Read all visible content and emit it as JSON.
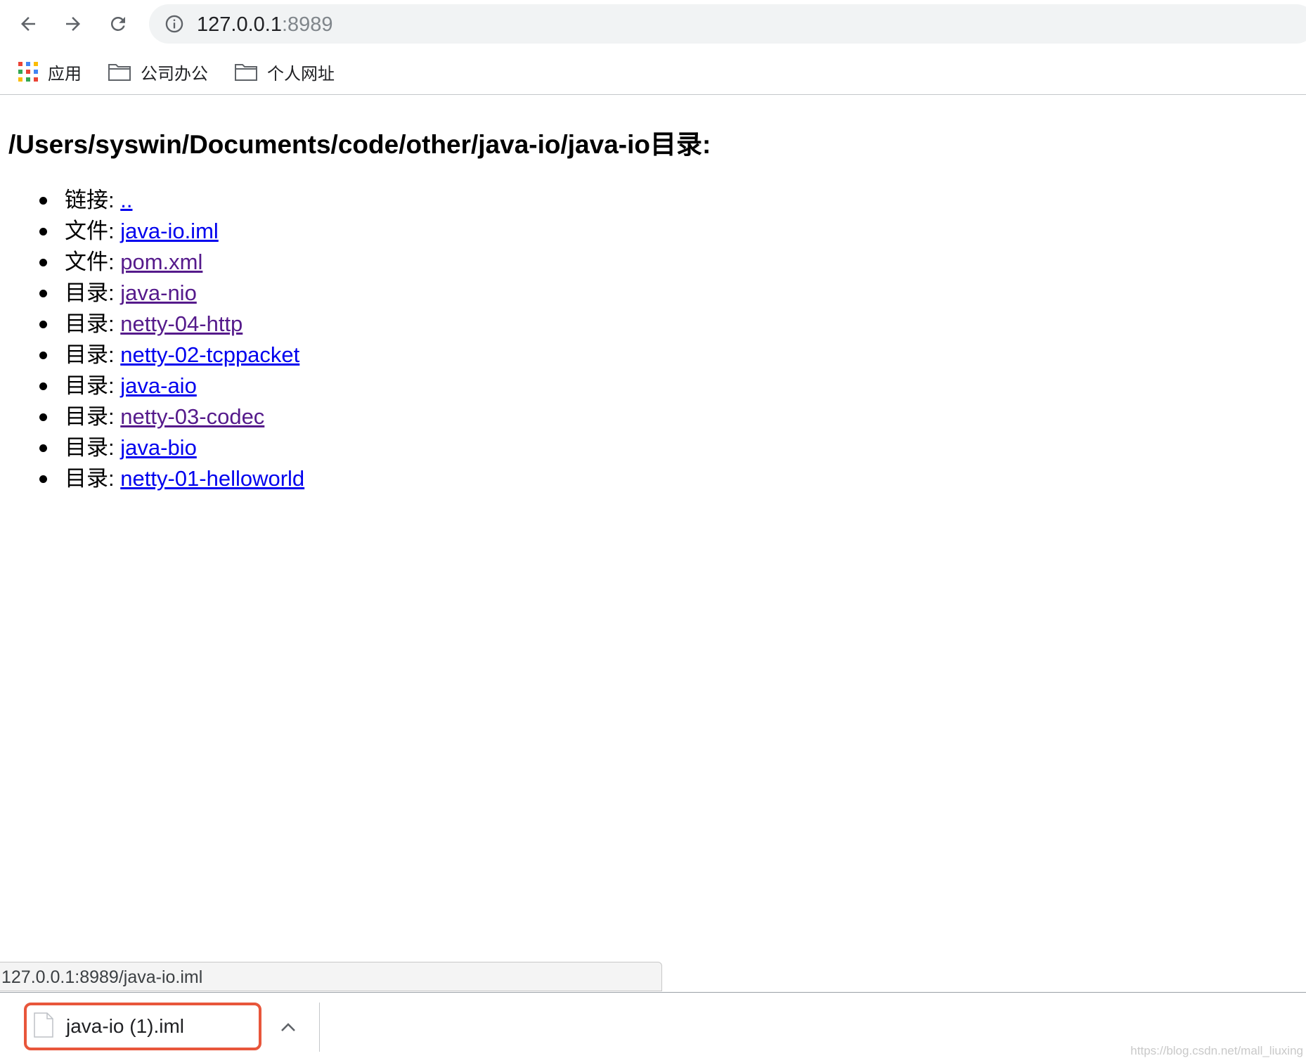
{
  "browser": {
    "url_host": "127.0.0.1",
    "url_port": ":8989",
    "icons": {
      "back": "arrow-left-icon",
      "forward": "arrow-right-icon",
      "reload": "reload-icon",
      "info": "info-icon"
    }
  },
  "bookmarks": [
    {
      "label": "应用",
      "icon": "apps-grid-icon"
    },
    {
      "label": "公司办公",
      "icon": "folder-icon"
    },
    {
      "label": "个人网址",
      "icon": "folder-icon"
    }
  ],
  "page": {
    "title": "/Users/syswin/Documents/code/other/java-io/java-io目录:",
    "entries": [
      {
        "kind": "链接:",
        "name": "..",
        "visited": false
      },
      {
        "kind": "文件:",
        "name": "java-io.iml",
        "visited": false
      },
      {
        "kind": "文件:",
        "name": "pom.xml",
        "visited": true
      },
      {
        "kind": "目录:",
        "name": "java-nio",
        "visited": true
      },
      {
        "kind": "目录:",
        "name": "netty-04-http",
        "visited": true
      },
      {
        "kind": "目录:",
        "name": "netty-02-tcppacket",
        "visited": false
      },
      {
        "kind": "目录:",
        "name": "java-aio",
        "visited": false
      },
      {
        "kind": "目录:",
        "name": "netty-03-codec",
        "visited": true
      },
      {
        "kind": "目录:",
        "name": "java-bio",
        "visited": false
      },
      {
        "kind": "目录:",
        "name": "netty-01-helloworld",
        "visited": false
      }
    ]
  },
  "status_bar": {
    "url": "127.0.0.1:8989/java-io.iml"
  },
  "download_shelf": {
    "file_name": "java-io (1).iml",
    "highlight_color": "#e8563b"
  },
  "watermark": "https://blog.csdn.net/mall_liuxing"
}
